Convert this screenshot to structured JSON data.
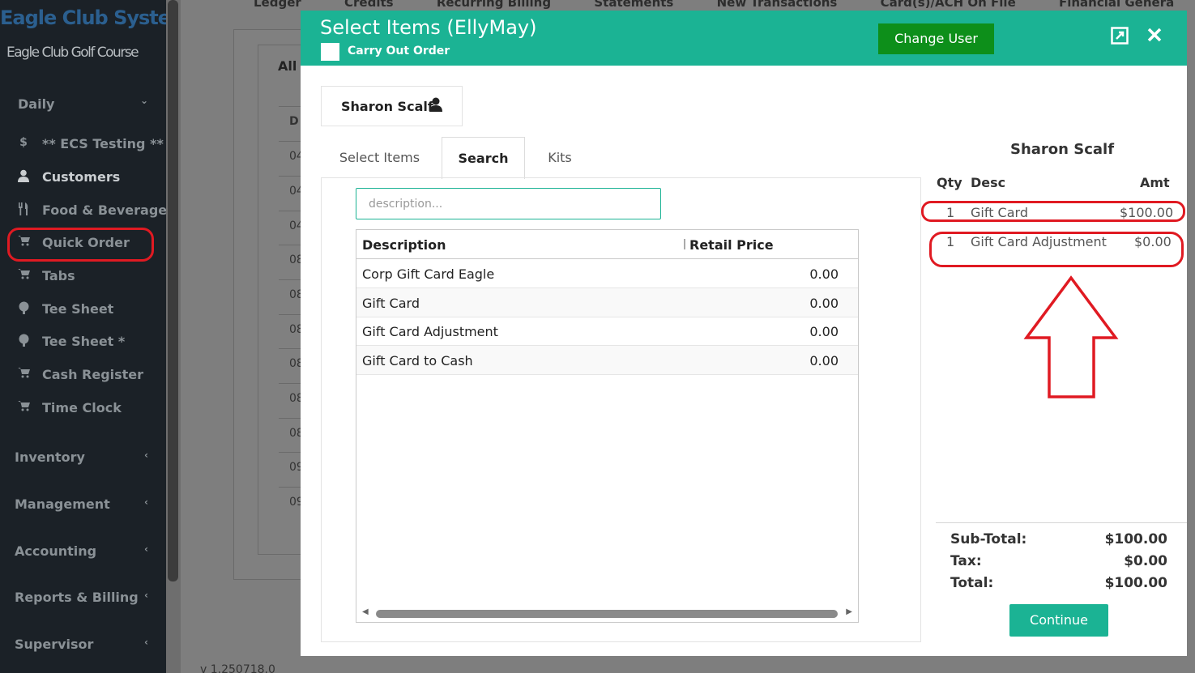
{
  "app": {
    "logo_text": "Eagle Club Systems",
    "club_name": "Eagle Club Golf Course",
    "version": "v 1.250718.0"
  },
  "sidebar": {
    "groups": [
      {
        "label": "Daily",
        "chevron": "⌄"
      },
      {
        "label": "Inventory",
        "chevron": "‹"
      },
      {
        "label": "Management",
        "chevron": "‹"
      },
      {
        "label": "Accounting",
        "chevron": "‹"
      },
      {
        "label": "Reports & Billing",
        "chevron": "‹"
      },
      {
        "label": "Supervisor",
        "chevron": "‹"
      }
    ],
    "items": [
      {
        "label": "** ECS Testing **",
        "icon": "dollar-icon",
        "glyph": "$"
      },
      {
        "label": "Customers",
        "icon": "user-icon",
        "glyph": "👤"
      },
      {
        "label": "Food & Beverage",
        "icon": "cutlery-icon",
        "glyph": "🍴"
      },
      {
        "label": "Quick Order",
        "icon": "cart-icon",
        "glyph": "🛒"
      },
      {
        "label": "Tabs",
        "icon": "cart-icon",
        "glyph": "🛒"
      },
      {
        "label": "Tee Sheet",
        "icon": "golf-ball-icon",
        "glyph": "●"
      },
      {
        "label": "Tee Sheet *",
        "icon": "golf-ball-icon",
        "glyph": "●"
      },
      {
        "label": "Cash Register",
        "icon": "cart-icon",
        "glyph": "🛒"
      },
      {
        "label": "Time Clock",
        "icon": "cart-icon",
        "glyph": "🛒"
      }
    ]
  },
  "background": {
    "tabs": [
      "Ledger",
      "Credits",
      "Recurring Billing",
      "Statements",
      "New Transactions",
      "Card(s)/ACH On File",
      "Financial Genera"
    ],
    "all_label": "All",
    "column_head": "D",
    "row_stubs": [
      "04",
      "04",
      "04",
      "08",
      "08",
      "08",
      "08",
      "08",
      "08",
      "09",
      "09"
    ]
  },
  "modal": {
    "title": "Select Items (EllyMay)",
    "carry_out_label": "Carry Out Order",
    "change_user_label": "Change User",
    "expand_icon": "expand-icon",
    "close_icon": "close-icon",
    "customer_name": "Sharon Scalf",
    "tabs": [
      "Select Items",
      "Search",
      "Kits"
    ],
    "active_tab": "Search",
    "search": {
      "placeholder": "description...",
      "value": ""
    },
    "grid": {
      "columns": [
        "Description",
        "Retail Price"
      ],
      "rows": [
        {
          "description": "Corp Gift Card Eagle",
          "price": "0.00"
        },
        {
          "description": "Gift Card",
          "price": "0.00"
        },
        {
          "description": "Gift Card Adjustment",
          "price": "0.00"
        },
        {
          "description": "Gift Card to Cash",
          "price": "0.00"
        }
      ]
    },
    "order": {
      "customer": "Sharon Scalf",
      "headers": {
        "qty": "Qty",
        "desc": "Desc",
        "amt": "Amt"
      },
      "lines": [
        {
          "qty": "1",
          "desc": "Gift Card",
          "amt": "$100.00"
        },
        {
          "qty": "1",
          "desc": "Gift Card Adjustment",
          "amt": "$0.00"
        }
      ],
      "subtotal_label": "Sub-Total:",
      "subtotal": "$100.00",
      "tax_label": "Tax:",
      "tax": "$0.00",
      "total_label": "Total:",
      "total": "$100.00"
    },
    "continue_label": "Continue"
  },
  "colors": {
    "accent": "#1bb394",
    "change_user": "#0d8f1a",
    "annotation": "#e01a22",
    "sidebar_bg": "#1b2127"
  }
}
